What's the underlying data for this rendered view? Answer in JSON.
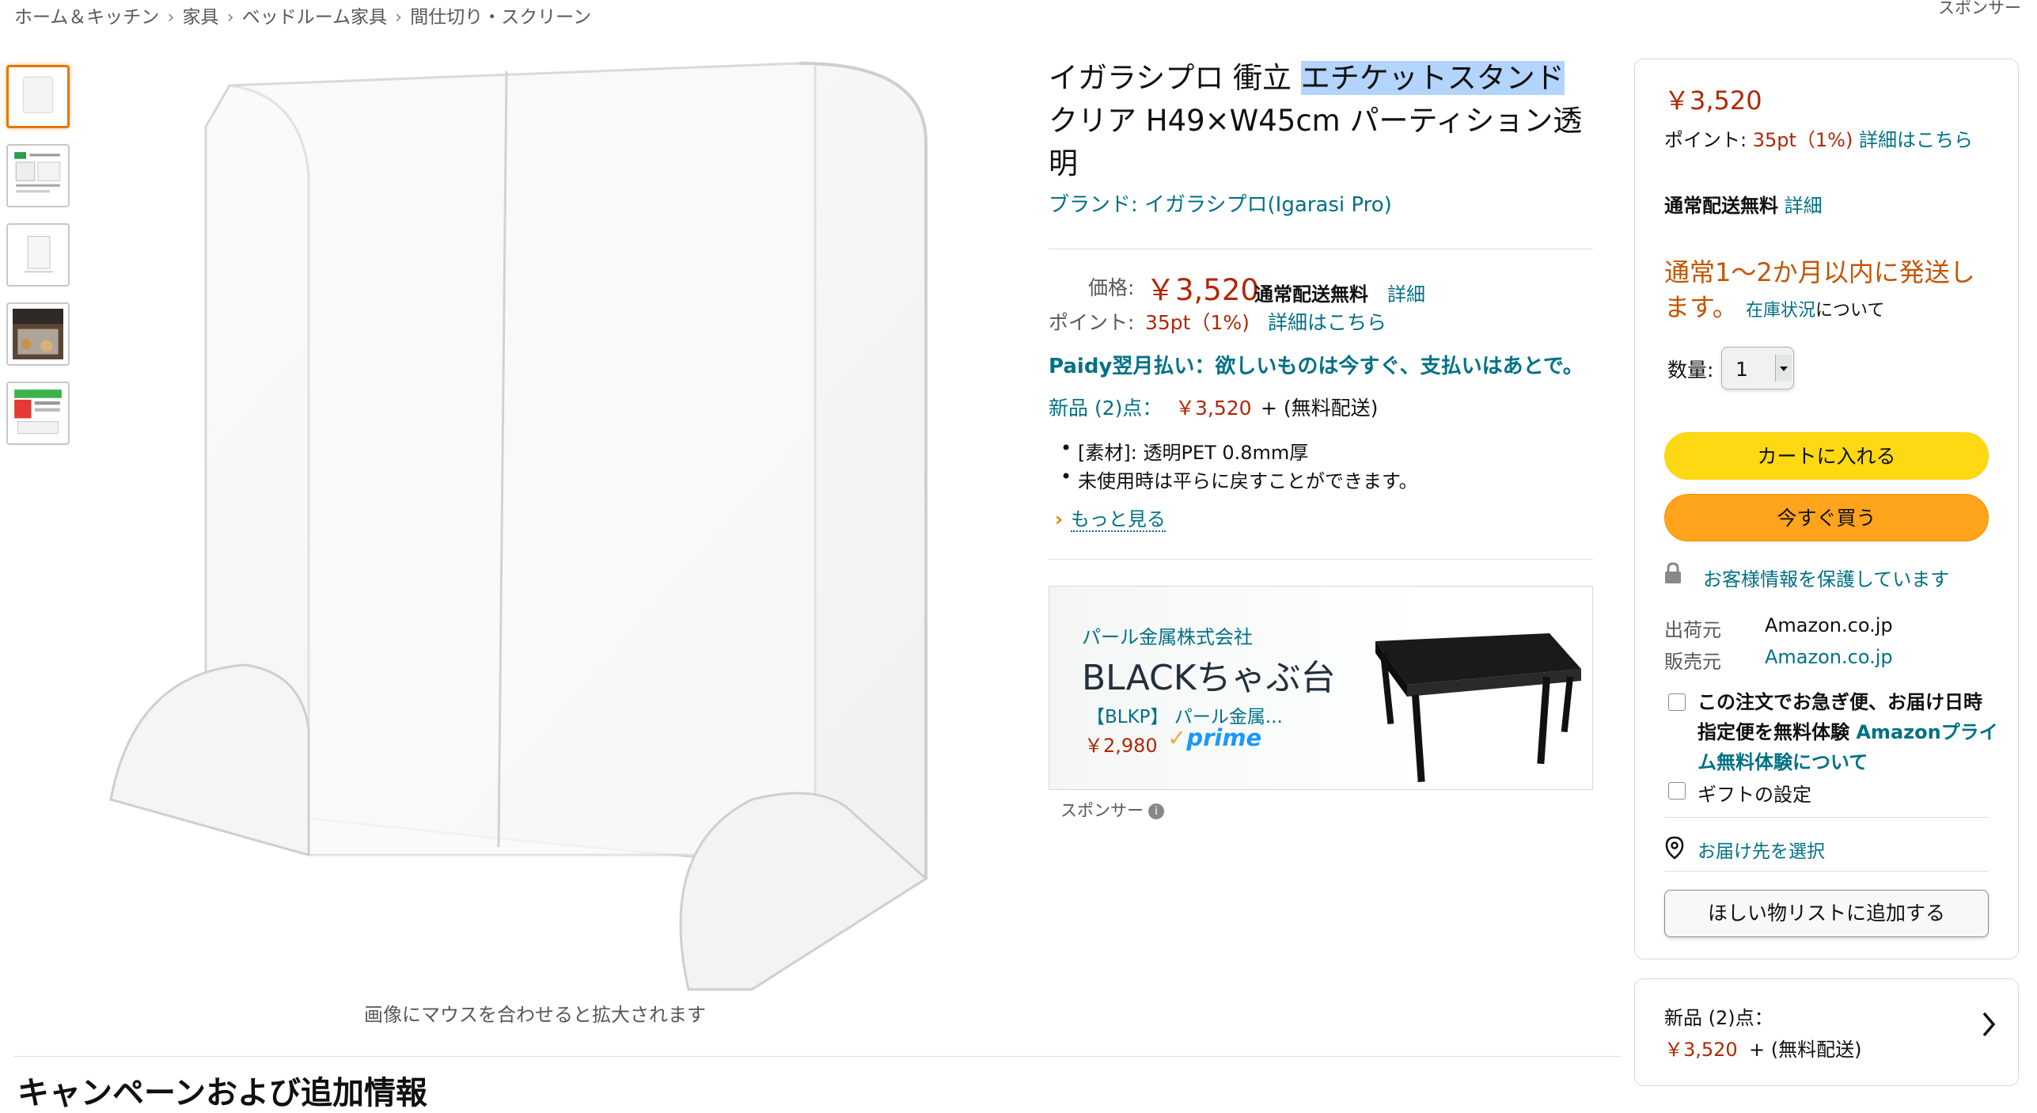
{
  "breadcrumb": [
    "ホーム＆キッチン",
    "家具",
    "ベッドルーム家具",
    "間仕切り・スクリーン"
  ],
  "breadcrumb_separator": "›",
  "sponsor_top": "スポンサー",
  "product": {
    "title_part1": "イガラシプロ 衝立 ",
    "title_highlight": "エチケットスタンド",
    "title_part2": "クリア H49×W45cm パーティション透明",
    "brand": "ブランド: イガラシプロ(Igarasi Pro)",
    "price_label": "価格:",
    "price": "￥3,520",
    "shipping_free": "通常配送無料",
    "shipping_detail": "詳細",
    "points_label": "ポイント:",
    "points_value": "35pt（1%)",
    "points_link": "詳細はこちら",
    "paidy": "Paidy翌月払い：欲しいものは今すぐ、支払いはあとで。",
    "new_count": "新品 (2)点：",
    "new_price": "￥3,520",
    "new_rest": "+ (無料配送)",
    "bullets": [
      "[素材]: 透明PET 0.8mm厚",
      "未使用時は平らに戻すことができます。"
    ],
    "see_more": "もっと見る",
    "zoom_hint": "画像にマウスを合わせると拡大されます"
  },
  "ad": {
    "seller": "パール金属株式会社",
    "title": "BLACKちゃぶ台",
    "item": "【BLKP】 パール金属...",
    "price": "￥2,980",
    "prime": "prime",
    "sponsor": "スポンサー"
  },
  "buybox": {
    "price": "￥3,520",
    "points_label": "ポイント: ",
    "points_value": "35pt（1%)",
    "points_link": "詳細はこちら",
    "ship_free": "通常配送無料",
    "ship_detail": "詳細",
    "delivery": "通常1〜2か月以内に発送します。",
    "stock_link": "在庫状況",
    "stock_suffix": "について",
    "qty_label": "数量:",
    "qty_value": "1",
    "cart_button": "カートに入れる",
    "buy_button": "今すぐ買う",
    "secure": "お客様情報を保護しています",
    "ship_from_label": "出荷元",
    "ship_from_value": "Amazon.co.jp",
    "seller_label": "販売元",
    "seller_value": "Amazon.co.jp",
    "express_text": "この注文でお急ぎ便、お届け日時指定便を無料体験",
    "express_link": "Amazonプライム無料体験について",
    "gift": "ギフトの設定",
    "address": "お届け先を選択",
    "wishlist": "ほしい物リストに追加する"
  },
  "others": {
    "count": "新品 (2)点：",
    "price": "￥3,520",
    "rest": "+ (無料配送)"
  },
  "campaign_heading": "キャンペーンおよび追加情報",
  "colors": {
    "price_red": "#b12704",
    "link": "#007185",
    "cart_yellow": "#ffd814",
    "buy_orange": "#ffa41c",
    "delivery_orange": "#c45500"
  }
}
